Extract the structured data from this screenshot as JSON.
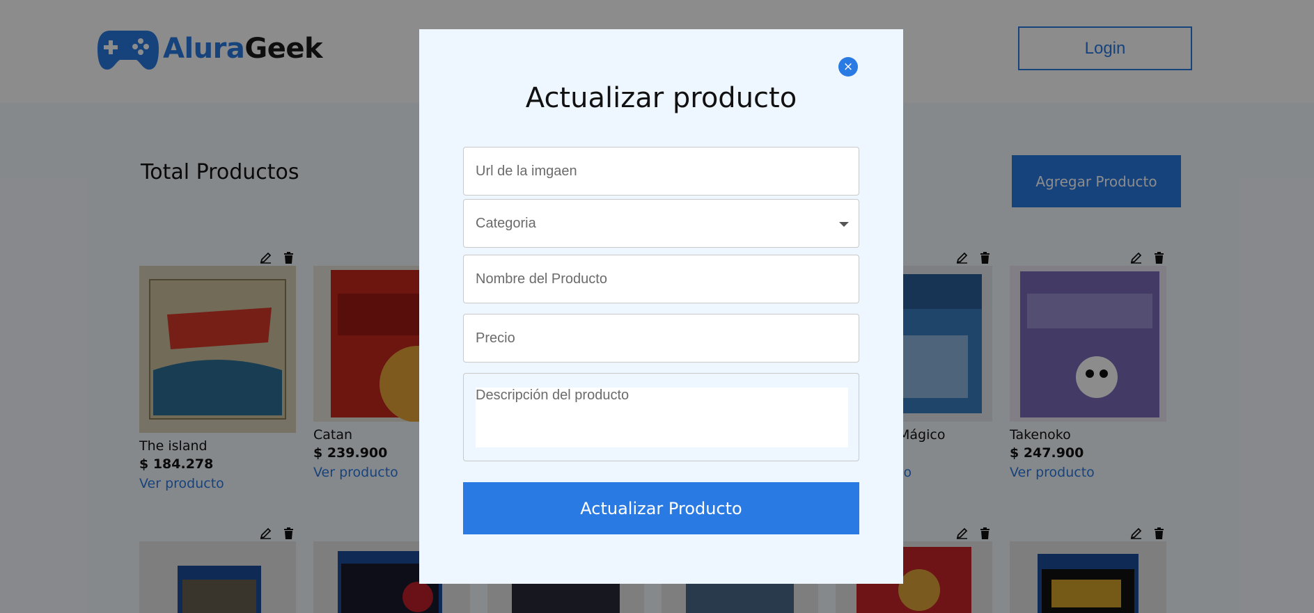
{
  "header": {
    "logo_part1": "Alura",
    "logo_part2": "Geek",
    "login_label": "Login"
  },
  "main": {
    "section_title": "Total Productos",
    "add_button_label": "Agregar Producto",
    "products": [
      {
        "name": "The island",
        "price": "$ 184.278",
        "link": "Ver producto"
      },
      {
        "name": "Catan",
        "price": "$ 239.900",
        "link": "Ver producto"
      },
      {
        "name": "Mágico",
        "price": "",
        "link": "to"
      },
      {
        "name": "Takenoko",
        "price": "$ 247.900",
        "link": "Ver producto"
      }
    ]
  },
  "modal": {
    "title": "Actualizar producto",
    "close_icon": "×",
    "fields": {
      "image_url_placeholder": "Url de la imgaen",
      "category_placeholder": "Categoria",
      "name_placeholder": "Nombre del Producto",
      "price_placeholder": "Precio",
      "description_placeholder": "Descripción del producto"
    },
    "submit_label": "Actualizar Producto"
  },
  "colors": {
    "accent": "#2a7ae4",
    "modal_bg": "#eef6ff",
    "overlay": "rgba(0,0,0,0.45)"
  },
  "icons": [
    "gamepad-icon",
    "edit-icon",
    "trash-icon",
    "close-icon",
    "chevron-down-icon"
  ]
}
